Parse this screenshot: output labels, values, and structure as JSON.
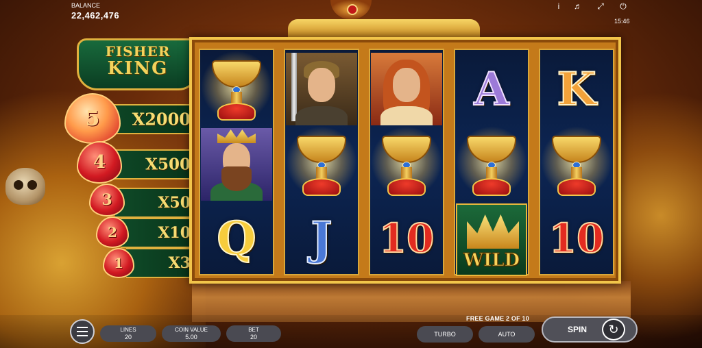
{
  "header": {
    "balance_label": "BALANCE",
    "balance_value": "22,462,476",
    "clock": "15:46",
    "icons": [
      "info-icon",
      "sound-icon",
      "fullscreen-icon",
      "power-icon"
    ]
  },
  "logo": {
    "line1": "FISHER",
    "line2": "KING"
  },
  "paytable": [
    {
      "count": "5",
      "payout": "X2000"
    },
    {
      "count": "4",
      "payout": "X500"
    },
    {
      "count": "3",
      "payout": "X50"
    },
    {
      "count": "2",
      "payout": "X10"
    },
    {
      "count": "1",
      "payout": "X3"
    }
  ],
  "reels": [
    [
      {
        "type": "grail"
      },
      {
        "type": "king"
      },
      {
        "type": "letter",
        "text": "Q"
      }
    ],
    [
      {
        "type": "knight"
      },
      {
        "type": "grail"
      },
      {
        "type": "letter",
        "text": "J"
      }
    ],
    [
      {
        "type": "lady"
      },
      {
        "type": "grail"
      },
      {
        "type": "letter",
        "text": "10"
      }
    ],
    [
      {
        "type": "letter",
        "text": "A"
      },
      {
        "type": "grail"
      },
      {
        "type": "wild",
        "text": "WILD"
      }
    ],
    [
      {
        "type": "letter",
        "text": "K"
      },
      {
        "type": "grail"
      },
      {
        "type": "letter",
        "text": "10"
      }
    ]
  ],
  "footer": {
    "free_game": "FREE GAME 2 OF 10",
    "lines_label": "LINES",
    "lines_value": "20",
    "coin_label": "COIN VALUE",
    "coin_value": "5.00",
    "bet_label": "BET",
    "bet_value": "20",
    "turbo": "TURBO",
    "auto": "AUTO",
    "spin": "SPIN"
  },
  "colors": {
    "accent_gold": "#f2c54a",
    "reel_bg": "#0c2553",
    "paytable_green": "#0f4a28"
  }
}
